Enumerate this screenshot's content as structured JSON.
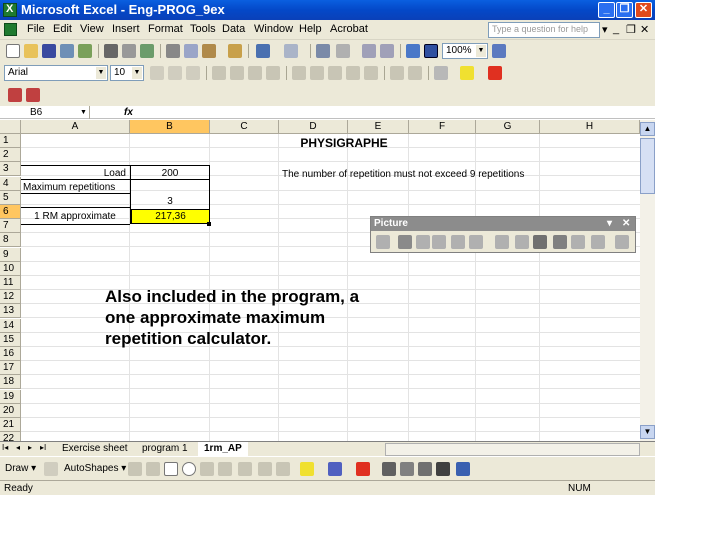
{
  "window": {
    "title": "Microsoft Excel - Eng-PROG_9ex",
    "min_label": "_",
    "max_label": "❐",
    "close_label": "✕"
  },
  "menu": {
    "items": [
      "File",
      "Edit",
      "View",
      "Insert",
      "Format",
      "Tools",
      "Data",
      "Window",
      "Help",
      "Acrobat"
    ],
    "help_placeholder": "Type a question for help",
    "doc_controls": [
      "▾",
      "_",
      "❐",
      "✕"
    ]
  },
  "toolbar": {
    "zoom": "100%",
    "font_name": "Arial",
    "font_size": "10"
  },
  "formula_bar": {
    "name_box": "B6",
    "fx": "fx",
    "value": ""
  },
  "grid": {
    "columns": [
      "A",
      "B",
      "C",
      "D",
      "E",
      "F",
      "G",
      "H"
    ],
    "rows": [
      "1",
      "2",
      "3",
      "4",
      "5",
      "6",
      "7",
      "8",
      "9",
      "10",
      "11",
      "12",
      "13",
      "14",
      "15",
      "16",
      "17",
      "18",
      "19",
      "20",
      "21",
      "22"
    ],
    "selected_column": "B",
    "selected_row": "6",
    "cells": {
      "D1": "PHYSIGRAPHE",
      "A3": "Load",
      "B3": "200",
      "D3": "The number of repetition must not exceed 9 repetitions",
      "A4": "Maximum repetitions",
      "B5": "3",
      "A6": "1 RM approximate",
      "B6": "217,36"
    },
    "highlight_color": "#ffff00"
  },
  "picture_toolbar": {
    "title": "Picture",
    "close_label": "✕",
    "dropdown_label": "▾"
  },
  "sheet_tabs": {
    "nav": [
      "I◂",
      "◂",
      "▸",
      "▸I"
    ],
    "tabs": [
      "Exercise sheet",
      "program 1",
      "1rm_AP"
    ],
    "active": "1rm_AP"
  },
  "draw_toolbar": {
    "draw_label": "Draw ▾",
    "autoshapes_label": "AutoShapes ▾"
  },
  "status": {
    "left": "Ready",
    "num": "NUM"
  },
  "caption": {
    "lines": [
      "Also included in the program, a",
      "one approximate maximum",
      "repetition calculator."
    ]
  },
  "colors": {
    "titlebar": "#0a5fe0",
    "chrome": "#ece9d8",
    "selected_header": "#ffc660"
  }
}
